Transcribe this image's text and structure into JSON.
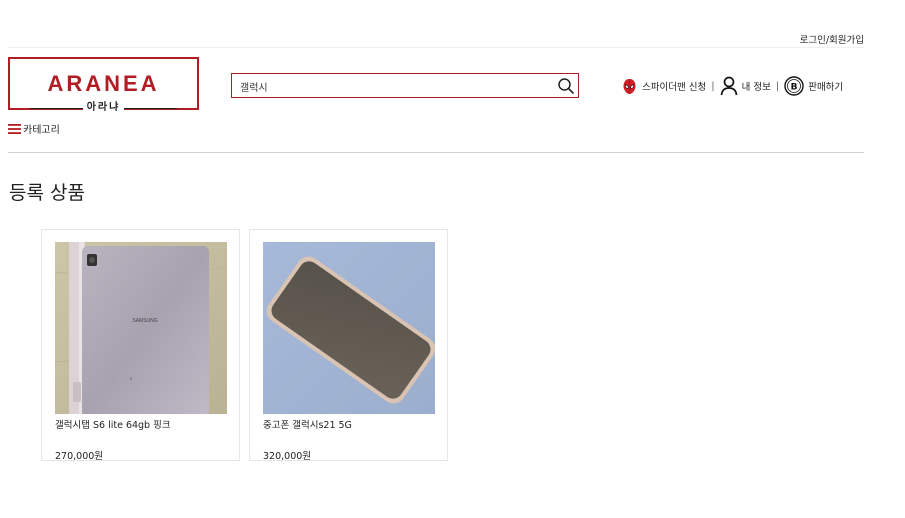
{
  "header": {
    "login_link": "로그인/회원가입",
    "logo": {
      "main": "ARANEA",
      "sub": "아라냐"
    },
    "search": {
      "value": "갤럭시",
      "placeholder": ""
    },
    "nav": [
      {
        "label": "스파이더맨 신청",
        "icon": "spiderman-icon"
      },
      {
        "label": "내 정보",
        "icon": "user-icon"
      },
      {
        "label": "판매하기",
        "icon": "bitcoin-icon"
      }
    ],
    "category_label": "카테고리"
  },
  "colors": {
    "accent": "#b01e23"
  },
  "main": {
    "section_title": "등록 상품",
    "products": [
      {
        "title": "갤럭시탭 S6 lite 64gb 핑크",
        "price": "270,000원",
        "image_label": "SAMSUNG",
        "image_sub": "S"
      },
      {
        "title": "중고폰 갤럭시s21 5G",
        "price": "320,000원"
      }
    ]
  }
}
